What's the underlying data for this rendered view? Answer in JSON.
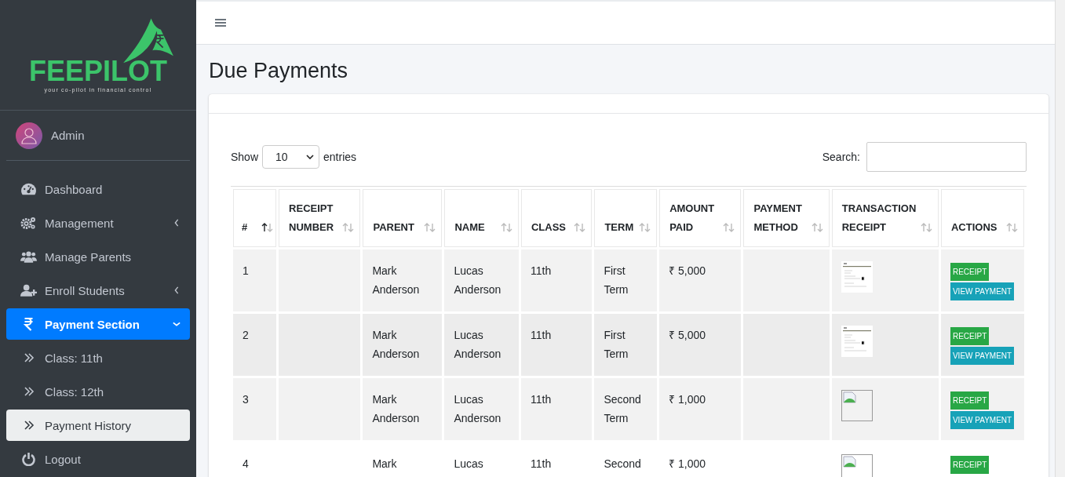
{
  "brand": {
    "name": "FEEPILOT",
    "tagline": "your co-pilot in financial control"
  },
  "user": {
    "name": "Admin"
  },
  "sidebar": {
    "items": [
      {
        "label": "Dashboard",
        "kind": "gauge",
        "active": false,
        "selected": false
      },
      {
        "label": "Management",
        "kind": "gears",
        "expanded": false,
        "active": false,
        "selected": false
      },
      {
        "label": "Manage Parents",
        "kind": "users",
        "active": false,
        "selected": false
      },
      {
        "label": "Enroll Students",
        "kind": "user-plus",
        "expanded": false,
        "active": false,
        "selected": false
      },
      {
        "label": "Payment Section",
        "kind": "rupee",
        "expanded": true,
        "active": true,
        "selected": false,
        "children": [
          {
            "label": "Class: 11th",
            "kind": "chevrons",
            "active": false,
            "selected": false
          },
          {
            "label": "Class: 12th",
            "kind": "chevrons",
            "active": false,
            "selected": false
          },
          {
            "label": "Payment History",
            "kind": "chevrons",
            "active": false,
            "selected": true
          }
        ]
      },
      {
        "label": "Logout",
        "kind": "power",
        "active": false,
        "selected": false
      }
    ]
  },
  "page_title": "Due Payments",
  "length_control": {
    "before": "Show",
    "value": "10",
    "after": "entries"
  },
  "search": {
    "label": "Search:"
  },
  "table": {
    "columns": [
      {
        "label": "#",
        "sorted": true
      },
      {
        "label": "RECEIPT NUMBER",
        "sorted": false
      },
      {
        "label": "PARENT",
        "sorted": false
      },
      {
        "label": "NAME",
        "sorted": false
      },
      {
        "label": "CLASS",
        "sorted": false
      },
      {
        "label": "TERM",
        "sorted": false
      },
      {
        "label": "AMOUNT PAID",
        "sorted": false
      },
      {
        "label": "PAYMENT METHOD",
        "sorted": false
      },
      {
        "label": "TRANSACTION RECEIPT",
        "sorted": false
      },
      {
        "label": "ACTIONS",
        "sorted": false
      }
    ],
    "rows": [
      {
        "number": "1",
        "parent": "Mark Anderson",
        "name": "Lucas Anderson",
        "class": "11th",
        "term": "First Term",
        "amount": "₹ 5,000",
        "receipt": {
          "kind": "document"
        },
        "actions": [
          "RECEIPT",
          "VIEW PAYMENT"
        ]
      },
      {
        "number": "2",
        "parent": "Mark Anderson",
        "name": "Lucas Anderson",
        "class": "11th",
        "term": "First Term",
        "amount": "₹ 5,000",
        "receipt": {
          "kind": "document"
        },
        "actions": [
          "RECEIPT",
          "VIEW PAYMENT"
        ]
      },
      {
        "number": "3",
        "parent": "Mark Anderson",
        "name": "Lucas Anderson",
        "class": "11th",
        "term": "Second Term",
        "amount": "₹ 1,000",
        "receipt": {
          "kind": "broken"
        },
        "actions": [
          "RECEIPT",
          "VIEW PAYMENT"
        ]
      },
      {
        "number": "4",
        "parent": "Mark",
        "name": "Lucas",
        "class": "11th",
        "term": "Second",
        "amount": "₹ 1,000",
        "receipt": {
          "kind": "broken"
        },
        "actions": [
          "RECEIPT"
        ]
      }
    ]
  }
}
